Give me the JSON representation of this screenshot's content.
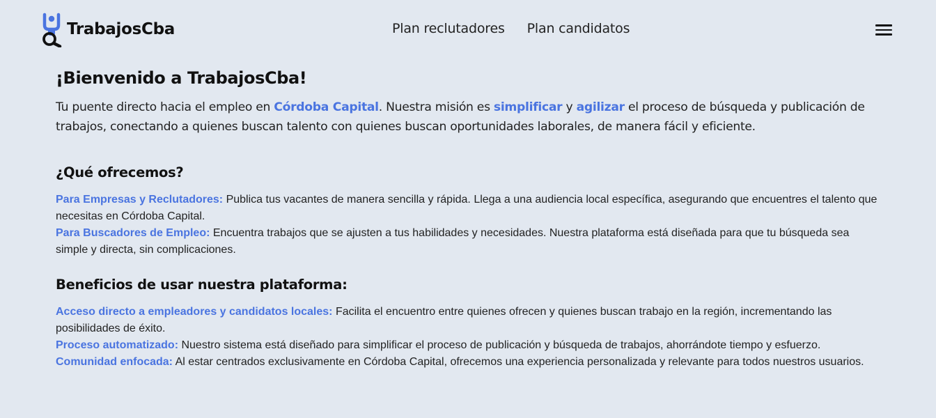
{
  "header": {
    "brand": "TrabajosCba",
    "nav": [
      "Plan reclutadores",
      "Plan candidatos"
    ]
  },
  "welcome": {
    "title": "¡Bienvenido a TrabajosCba!",
    "p1": "Tu puente directo hacia el empleo en ",
    "hl1": "Córdoba Capital",
    "p2": ". Nuestra misión es ",
    "hl2": "simplificar",
    "p3": " y ",
    "hl3": "agilizar",
    "p4": " el proceso de búsqueda y publicación de trabajos, conectando a quienes buscan talento con quienes buscan oportunidades laborales, de manera fácil y eficiente."
  },
  "offer": {
    "title": "¿Qué ofrecemos?",
    "items": [
      {
        "label": "Para Empresas y Reclutadores:",
        "text": " Publica tus vacantes de manera sencilla y rápida. Llega a una audiencia local específica, asegurando que encuentres el talento que necesitas en Córdoba Capital."
      },
      {
        "label": "Para Buscadores de Empleo:",
        "text": " Encuentra trabajos que se ajusten a tus habilidades y necesidades. Nuestra plataforma está diseñada para que tu búsqueda sea simple y directa, sin complicaciones."
      }
    ]
  },
  "benefits": {
    "title": "Beneficios de usar nuestra plataforma:",
    "items": [
      {
        "label": "Acceso directo a empleadores y candidatos locales:",
        "text": " Facilita el encuentro entre quienes ofrecen y quienes buscan trabajo en la región, incrementando las posibilidades de éxito."
      },
      {
        "label": "Proceso automatizado:",
        "text": " Nuestro sistema está diseñado para simplificar el proceso de publicación y búsqueda de trabajos, ahorrándote tiempo y esfuerzo."
      },
      {
        "label": "Comunidad enfocada:",
        "text": " Al estar centrados exclusivamente en Córdoba Capital, ofrecemos una experiencia personalizada y relevante para todos nuestros usuarios."
      }
    ]
  },
  "colors": {
    "background": "#e2e8f0",
    "accent": "#4a74e0",
    "text": "#222222"
  }
}
